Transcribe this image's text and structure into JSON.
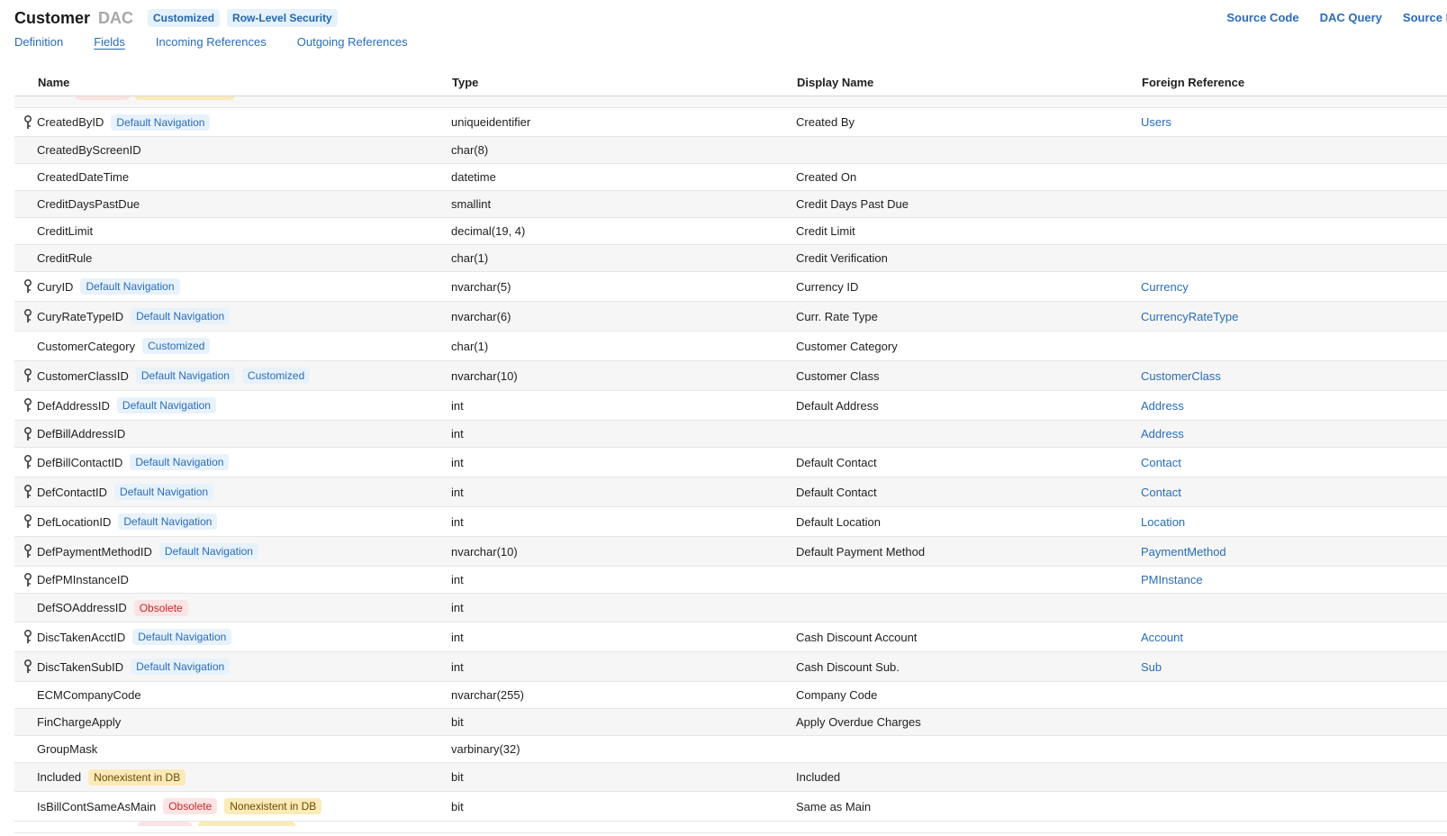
{
  "header": {
    "title": "Customer",
    "kind": "DAC",
    "badges": [
      "Customized",
      "Row-Level Security"
    ],
    "links": [
      "Source Code",
      "DAC Query",
      "Source D"
    ]
  },
  "tabs": [
    "Definition",
    "Fields",
    "Incoming References",
    "Outgoing References"
  ],
  "active_tab": "Fields",
  "columns": {
    "name": "Name",
    "type": "Type",
    "display": "Display Name",
    "ref": "Foreign Reference"
  },
  "rows": [
    {
      "name": "CreatedByID",
      "key": true,
      "tags": [
        {
          "text": "Default Navigation",
          "kind": "nav"
        }
      ],
      "type": "uniqueidentifier",
      "display": "Created By",
      "ref": "Users"
    },
    {
      "name": "CreatedByScreenID",
      "key": false,
      "tags": [],
      "type": "char(8)",
      "display": "",
      "ref": ""
    },
    {
      "name": "CreatedDateTime",
      "key": false,
      "tags": [],
      "type": "datetime",
      "display": "Created On",
      "ref": ""
    },
    {
      "name": "CreditDaysPastDue",
      "key": false,
      "tags": [],
      "type": "smallint",
      "display": "Credit Days Past Due",
      "ref": ""
    },
    {
      "name": "CreditLimit",
      "key": false,
      "tags": [],
      "type": "decimal(19, 4)",
      "display": "Credit Limit",
      "ref": ""
    },
    {
      "name": "CreditRule",
      "key": false,
      "tags": [],
      "type": "char(1)",
      "display": "Credit Verification",
      "ref": ""
    },
    {
      "name": "CuryID",
      "key": true,
      "tags": [
        {
          "text": "Default Navigation",
          "kind": "nav"
        }
      ],
      "type": "nvarchar(5)",
      "display": "Currency ID",
      "ref": "Currency"
    },
    {
      "name": "CuryRateTypeID",
      "key": true,
      "tags": [
        {
          "text": "Default Navigation",
          "kind": "nav"
        }
      ],
      "type": "nvarchar(6)",
      "display": "Curr. Rate Type",
      "ref": "CurrencyRateType"
    },
    {
      "name": "CustomerCategory",
      "key": false,
      "tags": [
        {
          "text": "Customized",
          "kind": "cust"
        }
      ],
      "type": "char(1)",
      "display": "Customer Category",
      "ref": ""
    },
    {
      "name": "CustomerClassID",
      "key": true,
      "tags": [
        {
          "text": "Default Navigation",
          "kind": "nav"
        },
        {
          "text": "Customized",
          "kind": "cust"
        }
      ],
      "type": "nvarchar(10)",
      "display": "Customer Class",
      "ref": "CustomerClass"
    },
    {
      "name": "DefAddressID",
      "key": true,
      "tags": [
        {
          "text": "Default Navigation",
          "kind": "nav"
        }
      ],
      "type": "int",
      "display": "Default Address",
      "ref": "Address"
    },
    {
      "name": "DefBillAddressID",
      "key": true,
      "tags": [],
      "type": "int",
      "display": "",
      "ref": "Address"
    },
    {
      "name": "DefBillContactID",
      "key": true,
      "tags": [
        {
          "text": "Default Navigation",
          "kind": "nav"
        }
      ],
      "type": "int",
      "display": "Default Contact",
      "ref": "Contact"
    },
    {
      "name": "DefContactID",
      "key": true,
      "tags": [
        {
          "text": "Default Navigation",
          "kind": "nav"
        }
      ],
      "type": "int",
      "display": "Default Contact",
      "ref": "Contact"
    },
    {
      "name": "DefLocationID",
      "key": true,
      "tags": [
        {
          "text": "Default Navigation",
          "kind": "nav"
        }
      ],
      "type": "int",
      "display": "Default Location",
      "ref": "Location"
    },
    {
      "name": "DefPaymentMethodID",
      "key": true,
      "tags": [
        {
          "text": "Default Navigation",
          "kind": "nav"
        }
      ],
      "type": "nvarchar(10)",
      "display": "Default Payment Method",
      "ref": "PaymentMethod"
    },
    {
      "name": "DefPMInstanceID",
      "key": true,
      "tags": [],
      "type": "int",
      "display": "",
      "ref": "PMInstance"
    },
    {
      "name": "DefSOAddressID",
      "key": false,
      "tags": [
        {
          "text": "Obsolete",
          "kind": "obs"
        }
      ],
      "type": "int",
      "display": "",
      "ref": ""
    },
    {
      "name": "DiscTakenAcctID",
      "key": true,
      "tags": [
        {
          "text": "Default Navigation",
          "kind": "nav"
        }
      ],
      "type": "int",
      "display": "Cash Discount Account",
      "ref": "Account"
    },
    {
      "name": "DiscTakenSubID",
      "key": true,
      "tags": [
        {
          "text": "Default Navigation",
          "kind": "nav"
        }
      ],
      "type": "int",
      "display": "Cash Discount Sub.",
      "ref": "Sub"
    },
    {
      "name": "ECMCompanyCode",
      "key": false,
      "tags": [],
      "type": "nvarchar(255)",
      "display": "Company Code",
      "ref": ""
    },
    {
      "name": "FinChargeApply",
      "key": false,
      "tags": [],
      "type": "bit",
      "display": "Apply Overdue Charges",
      "ref": ""
    },
    {
      "name": "GroupMask",
      "key": false,
      "tags": [],
      "type": "varbinary(32)",
      "display": "",
      "ref": ""
    },
    {
      "name": "Included",
      "key": false,
      "tags": [
        {
          "text": "Nonexistent in DB",
          "kind": "nonex"
        }
      ],
      "type": "bit",
      "display": "Included",
      "ref": ""
    },
    {
      "name": "IsBillContSameAsMain",
      "key": false,
      "tags": [
        {
          "text": "Obsolete",
          "kind": "obs"
        },
        {
          "text": "Nonexistent in DB",
          "kind": "nonex"
        }
      ],
      "type": "bit",
      "display": "Same as Main",
      "ref": ""
    }
  ],
  "colors": {
    "link": "#2a6cb8",
    "badge_bg": "#e5f1fb",
    "obsolete_bg": "#fde4e4",
    "obsolete_fg": "#c62828",
    "nonexistent_bg": "#fcebb9"
  }
}
